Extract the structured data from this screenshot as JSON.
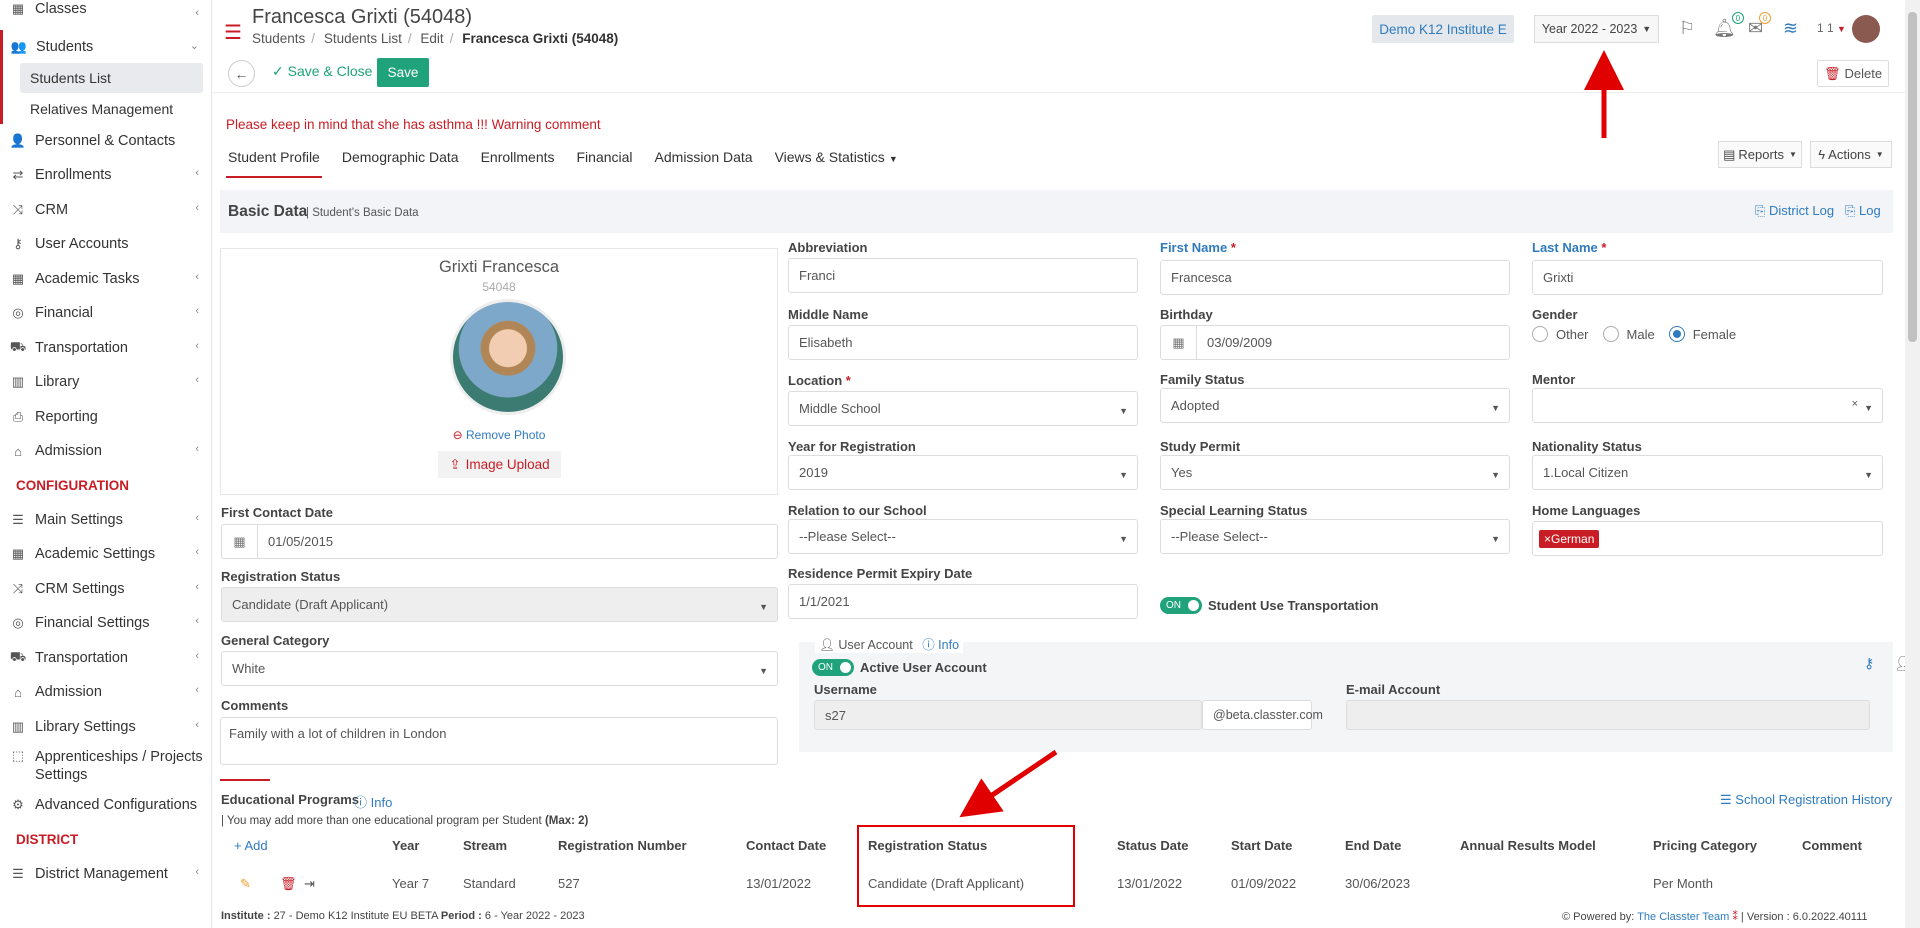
{
  "sidebar": {
    "items": [
      {
        "label": "Classes",
        "icon": "classes-icon"
      },
      {
        "label": "Students",
        "icon": "students-icon"
      },
      {
        "label": "Personnel & Contacts",
        "icon": "personnel-icon"
      },
      {
        "label": "Enrollments",
        "icon": "enrollments-icon"
      },
      {
        "label": "CRM",
        "icon": "crm-icon"
      },
      {
        "label": "User Accounts",
        "icon": "key-icon"
      },
      {
        "label": "Academic Tasks",
        "icon": "grid-icon"
      },
      {
        "label": "Financial",
        "icon": "coins-icon"
      },
      {
        "label": "Transportation",
        "icon": "bus-icon"
      },
      {
        "label": "Library",
        "icon": "books-icon"
      },
      {
        "label": "Reporting",
        "icon": "printer-icon"
      },
      {
        "label": "Admission",
        "icon": "bank-icon"
      }
    ],
    "sub_items": [
      "Students List",
      "Relatives Management"
    ],
    "config_header": "CONFIGURATION",
    "config_items": [
      {
        "label": "Main Settings",
        "icon": "sliders-icon"
      },
      {
        "label": "Academic Settings",
        "icon": "grid-icon"
      },
      {
        "label": "CRM Settings",
        "icon": "crm-icon"
      },
      {
        "label": "Financial Settings",
        "icon": "coins-icon"
      },
      {
        "label": "Transportation",
        "icon": "bus-icon"
      },
      {
        "label": "Admission",
        "icon": "bank-icon"
      },
      {
        "label": "Library Settings",
        "icon": "books-icon"
      },
      {
        "label": "Apprenticeships / Projects Settings",
        "icon": "box-icon"
      },
      {
        "label": "Advanced Configurations",
        "icon": "gears-icon"
      }
    ],
    "district_header": "DISTRICT",
    "district_items": [
      {
        "label": "District Management",
        "icon": "list-icon"
      }
    ]
  },
  "header": {
    "title": "Francesca Grixti (54048)",
    "breadcrumb": [
      "Students",
      "Students List",
      "Edit",
      "Francesca Grixti (54048)"
    ],
    "institute": "Demo K12 Institute E",
    "year": "Year 2022 - 2023",
    "notif_count": "0",
    "mail_count": "0",
    "user_num": "1 1"
  },
  "toolbar": {
    "save_close": "Save & Close",
    "save": "Save",
    "delete": "Delete"
  },
  "warning": "Please keep in mind that she has asthma !!! Warning comment",
  "tabs": [
    "Student Profile",
    "Demographic Data",
    "Enrollments",
    "Financial",
    "Admission Data",
    "Views & Statistics"
  ],
  "reports_label": "Reports",
  "actions_label": "Actions",
  "section": {
    "title": "Basic Data",
    "subtitle": "Student's Basic Data",
    "district_log": "District Log",
    "log": "Log"
  },
  "profile": {
    "name": "Grixti Francesca",
    "id": "54048",
    "remove_photo": "Remove Photo",
    "upload": "Image Upload"
  },
  "fields": {
    "abbreviation": {
      "label": "Abbreviation",
      "value": "Franci"
    },
    "first_name": {
      "label": "First Name",
      "value": "Francesca"
    },
    "last_name": {
      "label": "Last Name",
      "value": "Grixti"
    },
    "middle_name": {
      "label": "Middle Name",
      "value": "Elisabeth"
    },
    "birthday": {
      "label": "Birthday",
      "value": "03/09/2009"
    },
    "gender": {
      "label": "Gender",
      "options": [
        "Other",
        "Male",
        "Female"
      ],
      "selected": "Female"
    },
    "location": {
      "label": "Location",
      "value": "Middle School"
    },
    "family_status": {
      "label": "Family Status",
      "value": "Adopted"
    },
    "mentor": {
      "label": "Mentor",
      "value": ""
    },
    "year_reg": {
      "label": "Year for Registration",
      "value": "2019"
    },
    "study_permit": {
      "label": "Study Permit",
      "value": "Yes"
    },
    "nationality": {
      "label": "Nationality Status",
      "value": "1.Local Citizen"
    },
    "relation": {
      "label": "Relation to our School",
      "value": "--Please Select--"
    },
    "special_learning": {
      "label": "Special Learning Status",
      "value": "--Please Select--"
    },
    "home_languages": {
      "label": "Home Languages",
      "value": "German"
    },
    "first_contact": {
      "label": "First Contact Date",
      "value": "01/05/2015"
    },
    "residence_permit": {
      "label": "Residence Permit Expiry Date",
      "value": "1/1/2021"
    },
    "transportation": {
      "label": "Student Use Transportation",
      "toggle": "ON"
    },
    "reg_status": {
      "label": "Registration Status",
      "value": "Candidate (Draft Applicant)"
    },
    "general_category": {
      "label": "General Category",
      "value": "White"
    },
    "comments": {
      "label": "Comments",
      "value": "Family with a lot of children in London"
    }
  },
  "user_account": {
    "title": "User Account",
    "info": "Info",
    "active_label": "Active User Account",
    "toggle": "ON",
    "username_label": "Username",
    "username": "s27",
    "domain": "@beta.classter.com",
    "email_label": "E-mail Account",
    "email": ""
  },
  "programs": {
    "title": "Educational Programs",
    "info": "Info",
    "note": "| You may add more than one educational program per Student",
    "note_max": "(Max: 2)",
    "history": "School Registration History",
    "add": "Add",
    "columns": [
      "Year",
      "Stream",
      "Registration Number",
      "Contact Date",
      "Registration Status",
      "Status Date",
      "Start Date",
      "End Date",
      "Annual Results Model",
      "Pricing Category",
      "Comment"
    ],
    "rows": [
      {
        "year": "Year 7",
        "stream": "Standard",
        "reg_no": "527",
        "contact_date": "13/01/2022",
        "status": "Candidate (Draft Applicant)",
        "status_date": "13/01/2022",
        "start": "01/09/2022",
        "end": "30/06/2023",
        "annual": "",
        "pricing": "Per Month",
        "comment": ""
      }
    ]
  },
  "footer": {
    "institute_label": "Institute :",
    "institute": "27 - Demo K12 Institute EU BETA",
    "period_label": "Period :",
    "period": "6 - Year 2022 - 2023",
    "powered": "Powered by:",
    "team": "The Classter Team",
    "version": "| Version : 6.0.2022.40111"
  },
  "colors": {
    "accent": "#c81d25",
    "link": "#2f7bbf",
    "green": "#20a37a",
    "annotation": "#e00000"
  }
}
